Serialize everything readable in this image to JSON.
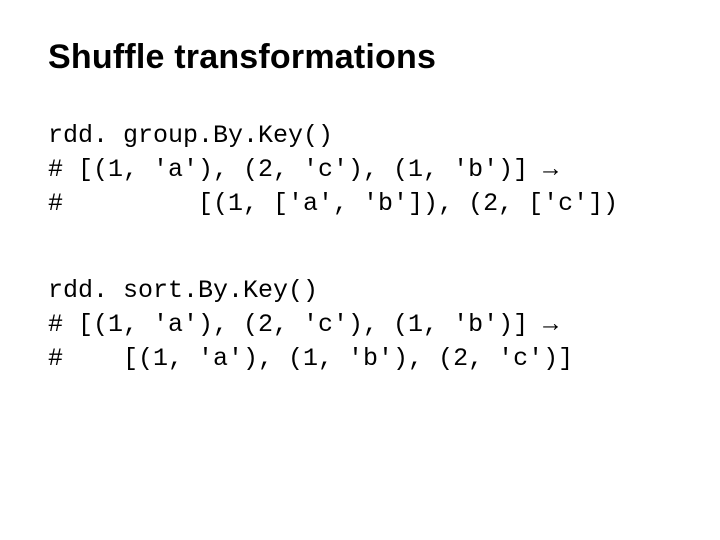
{
  "title": "Shuffle transformations",
  "block1": {
    "line1": "rdd. group.By.Key()",
    "line2": "# [(1, 'a'), (2, 'c'), (1, 'b')] →",
    "line3": "#         [(1, ['a', 'b']), (2, ['c'])"
  },
  "block2": {
    "line1": "rdd. sort.By.Key()",
    "line2": "# [(1, 'a'), (2, 'c'), (1, 'b')] →",
    "line3": "#    [(1, 'a'), (1, 'b'), (2, 'c')]"
  }
}
